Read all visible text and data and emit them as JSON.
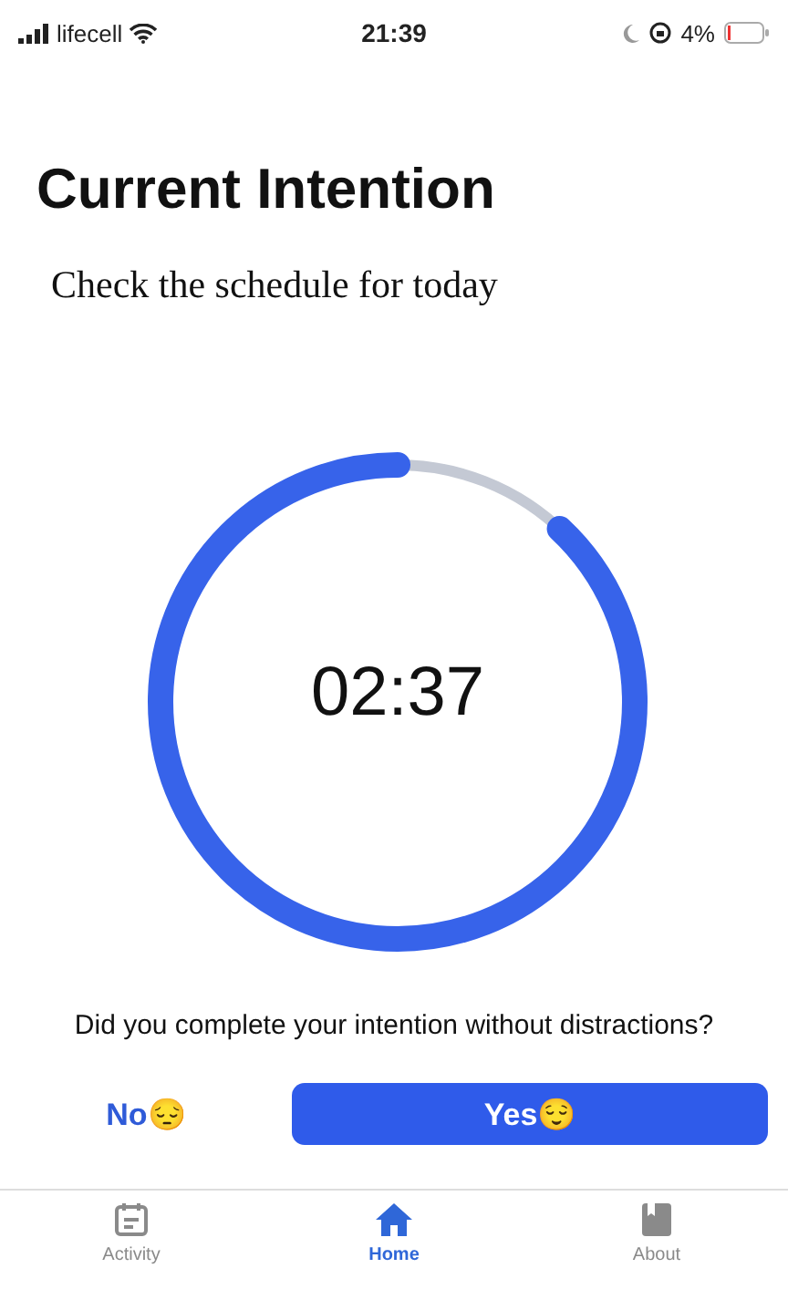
{
  "status_bar": {
    "carrier": "lifecell",
    "time": "21:39",
    "battery": "4%"
  },
  "title": "Current Intention",
  "intention": "Check the schedule for today",
  "timer": {
    "time": "02:37",
    "level": 0.88
  },
  "question": "Did you complete your intention without distractions?",
  "buttons": [
    {
      "label": "No",
      "emoji": "😔",
      "kind": "plain"
    },
    {
      "label": "Yes",
      "emoji": "😌",
      "kind": "filled"
    }
  ],
  "tabs": [
    {
      "label": "Activity",
      "kind": "calendar",
      "selected": false
    },
    {
      "label": "Home",
      "kind": "home",
      "selected": true
    },
    {
      "label": "About",
      "kind": "book",
      "selected": false
    }
  ]
}
